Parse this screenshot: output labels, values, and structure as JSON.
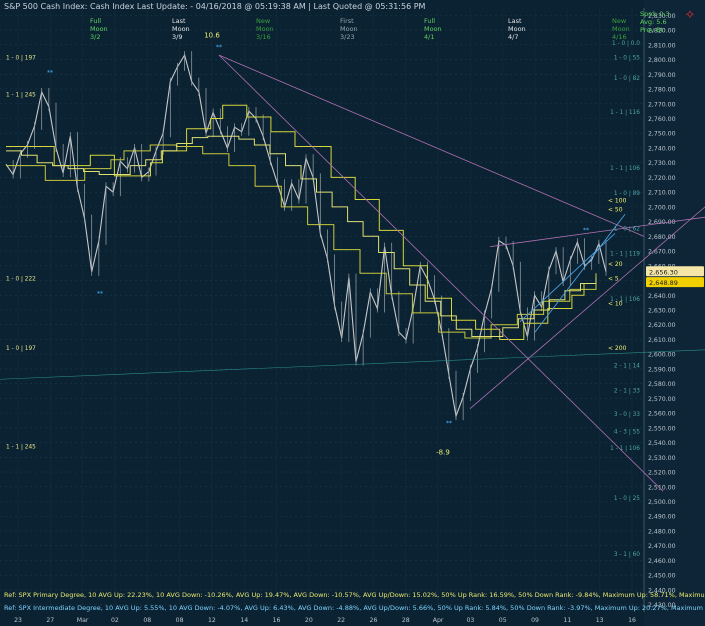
{
  "header": {
    "title": "S&P 500 Cash Index:  Cash Index  Last Update:  - 04/16/2018 @ 05:19:38 AM | Last Quoted @ 05:31:56 PM"
  },
  "moon_labels": [
    {
      "phase": [
        "Full",
        "Moon"
      ],
      "date": "3/2",
      "color": "#5fd35f"
    },
    {
      "phase": [
        "Last",
        "Moon"
      ],
      "date": "3/9",
      "color": "#e6e6e6"
    },
    {
      "phase": [
        "New",
        "Moon"
      ],
      "date": "3/16",
      "color": "#3aa03a"
    },
    {
      "phase": [
        "First",
        "Moon"
      ],
      "date": "3/23",
      "color": "#9aa5ad"
    },
    {
      "phase": [
        "Full",
        "Moon"
      ],
      "date": "4/1",
      "color": "#5fd35f"
    },
    {
      "phase": [
        "Last",
        "Moon"
      ],
      "date": "4/7",
      "color": "#e6e6e6"
    },
    {
      "phase": [
        "New",
        "Moon"
      ],
      "date": "4/16",
      "color": "#3aa03a"
    }
  ],
  "stats": {
    "spd": "Sprd: 0.3",
    "avg": "Avg: 5.6",
    "prev": "Prev Bt:"
  },
  "footer": {
    "ref1": "Ref: SPX Primary Degree, 10 AVG Up: 22.23%, 10 AVG Down: -10.26%, AVG Up: 19.47%, AVG Down: -10.57%, AVG Up/Down: 15.02%, 50%  Up Rank: 16.59%, 50% Down Rank: -9.84%, Maximum Up: 58.71%, Maximum",
    "ref2": "Ref: SPX Intermediate Degree, 10 AVG Up: 5.55%, 10 AVG Down: -4.07%, AVG Up: 6.43%, AVG Down: -4.88%, AVG Up/Down: 5.66%, 50%  Up Rank: 5.84%, 50% Down Rank: -3.97%, Maximum Up: 20.27%, Maximum Dow"
  },
  "chart_data": {
    "type": "line",
    "title": "",
    "ylim": [
      2425,
      2835
    ],
    "y_ticks": [
      2430,
      2440,
      2450,
      2460,
      2470,
      2480,
      2490,
      2500,
      2510,
      2520,
      2530,
      2540,
      2550,
      2560,
      2570,
      2580,
      2590,
      2600,
      2610,
      2620,
      2630,
      2640,
      2650,
      2660,
      2670,
      2680,
      2690,
      2700,
      2710,
      2720,
      2730,
      2740,
      2750,
      2760,
      2770,
      2780,
      2790,
      2800,
      2810,
      2820,
      2830
    ],
    "y_tick_labels": [
      "2,430.00",
      "2,440.00",
      "2,450.00",
      "2,460.00",
      "2,470.00",
      "2,480.00",
      "2,490.00",
      "2,500.00",
      "2,510.00",
      "2,520.00",
      "2,530.00",
      "2,540.00",
      "2,550.00",
      "2,560.00",
      "2,570.00",
      "2,580.00",
      "2,590.00",
      "2,600.00",
      "2,610.00",
      "2,620.00",
      "2,630.00",
      "2,640.00",
      "2,650.00",
      "2,660.00",
      "2,670.00",
      "2,680.00",
      "2,690.00",
      "2,700.00",
      "2,710.00",
      "2,720.00",
      "2,730.00",
      "2,740.00",
      "2,750.00",
      "2,760.00",
      "2,770.00",
      "2,780.00",
      "2,790.00",
      "2,800.00",
      "2,810.00",
      "2,820.00",
      "2,830.00"
    ],
    "x_labels": [
      "23",
      "27",
      "Mar",
      "02",
      "08",
      "08",
      "12",
      "14",
      "16",
      "20",
      "22",
      "26",
      "28",
      "Apr",
      "03",
      "05",
      "09",
      "11",
      "13",
      "16"
    ],
    "price_series": {
      "name": "S&P 500 Cash Index",
      "color": "#c8c8c8",
      "values": [
        2729,
        2722,
        2736,
        2742,
        2755,
        2778,
        2768,
        2740,
        2723,
        2748,
        2713,
        2692,
        2656,
        2677,
        2714,
        2710,
        2731,
        2726,
        2740,
        2720,
        2724,
        2738,
        2750,
        2785,
        2795,
        2803,
        2785,
        2778,
        2750,
        2764,
        2752,
        2740,
        2754,
        2751,
        2765,
        2760,
        2748,
        2731,
        2716,
        2700,
        2716,
        2705,
        2733,
        2720,
        2682,
        2665,
        2633,
        2611,
        2652,
        2595,
        2614,
        2642,
        2631,
        2673,
        2640,
        2615,
        2610,
        2631,
        2660,
        2651,
        2637,
        2615,
        2586,
        2558,
        2571,
        2590,
        2604,
        2627,
        2645,
        2677,
        2674,
        2660,
        2629,
        2612,
        2640,
        2632,
        2657,
        2670,
        2649,
        2664,
        2676,
        2660,
        2664,
        2675,
        2656
      ]
    },
    "yellow_series": [
      {
        "name": "",
        "color": "#d6d63a",
        "values": [
          2741,
          2741,
          2741,
          2741,
          2728,
          2728,
          2728,
          2735,
          2735,
          2721,
          2721,
          2721,
          2730,
          2738,
          2738,
          2753,
          2753,
          2760,
          2769,
          2769,
          2761,
          2761,
          2751,
          2751,
          2741,
          2741,
          2741,
          2720,
          2720,
          2705,
          2705,
          2684,
          2684,
          2660,
          2660,
          2638,
          2638,
          2623,
          2623,
          2617,
          2617,
          2610,
          2610,
          2621,
          2621,
          2631,
          2631,
          2640,
          2648,
          2655
        ]
      },
      {
        "name": "",
        "color": "#c8c83a",
        "values": [
          2728,
          2728,
          2728,
          2718,
          2718,
          2718,
          2726,
          2726,
          2732,
          2738,
          2738,
          2742,
          2742,
          2741,
          2741,
          2736,
          2736,
          2728,
          2728,
          2714,
          2714,
          2700,
          2700,
          2688,
          2688,
          2671,
          2671,
          2655,
          2655,
          2641,
          2641,
          2628,
          2628,
          2615,
          2615,
          2611,
          2611,
          2620,
          2620,
          2627,
          2627,
          2636,
          2636,
          2644,
          2644,
          2650
        ]
      },
      {
        "name": "",
        "color": "#e0e070",
        "values": [
          2738,
          2735,
          2730,
          2728,
          2726,
          2724,
          2722,
          2722,
          2728,
          2732,
          2738,
          2743,
          2747,
          2748,
          2748,
          2746,
          2742,
          2736,
          2728,
          2719,
          2710,
          2700,
          2690,
          2680,
          2669,
          2658,
          2647,
          2636,
          2626,
          2617,
          2612,
          2612,
          2618,
          2624,
          2630,
          2637,
          2643,
          2648,
          2652
        ]
      }
    ],
    "markers": [
      {
        "text": "10.6",
        "color": "#f0f070"
      },
      {
        "text": "-8.9",
        "color": "#f0f070"
      }
    ],
    "left_labels": [
      {
        "text": "1 - 0 | 197",
        "value": 2800
      },
      {
        "text": "1 - 1 | 245",
        "value": 2775
      },
      {
        "text": "1 - 0 | 222",
        "value": 2650
      },
      {
        "text": "1 - 0 | 197",
        "value": 2603
      },
      {
        "text": "1 - 1 | 245",
        "value": 2536
      }
    ],
    "right_labels": [
      {
        "text": "1 - 0 | 0.0",
        "value": 2810
      },
      {
        "text": "1 - 0 | 55",
        "value": 2800
      },
      {
        "text": "1 - 0 | 82",
        "value": 2786
      },
      {
        "text": "1 - 1 | 116",
        "value": 2763
      },
      {
        "text": "1 - 1 | 106",
        "value": 2725
      },
      {
        "text": "1 - 0 | 89",
        "value": 2708
      },
      {
        "text": "1 - 0 | 62",
        "value": 2684
      },
      {
        "text": "1 - 1 | 119",
        "value": 2667
      },
      {
        "text": "1 - 1 | 106",
        "value": 2636
      },
      {
        "text": "2 - 1 | 14",
        "value": 2591
      },
      {
        "text": "2 - 1 | 33",
        "value": 2574
      },
      {
        "text": "3 - 0 | 33",
        "value": 2558
      },
      {
        "text": "4 - 3 | 55",
        "value": 2546
      },
      {
        "text": "1 - 1 | 106",
        "value": 2535
      },
      {
        "text": "1 - 0 | 25",
        "value": 2501
      },
      {
        "text": "3 - 1 | 60",
        "value": 2463
      }
    ],
    "ma_labels": [
      {
        "text": "< 100",
        "value": 2703
      },
      {
        "text": "< 50",
        "value": 2697
      },
      {
        "text": "< 20",
        "value": 2660
      },
      {
        "text": "< 5",
        "value": 2650
      },
      {
        "text": "< 10",
        "value": 2633
      },
      {
        "text": "< 200",
        "value": 2603
      }
    ],
    "price_tags": [
      {
        "text": "2,656.30",
        "value": 2656.3,
        "bg": "#f5e6a8"
      },
      {
        "text": "2,648.89",
        "value": 2648.89,
        "bg": "#f0d000"
      }
    ],
    "grid": true
  }
}
